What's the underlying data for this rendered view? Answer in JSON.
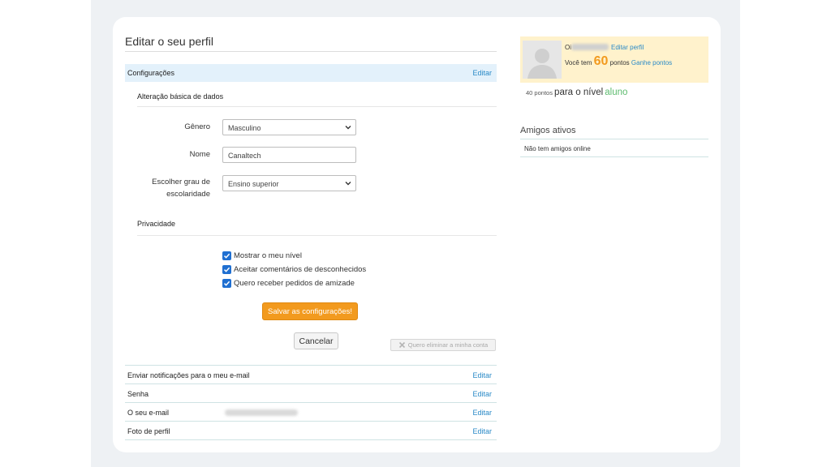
{
  "page": {
    "title": "Editar o seu perfil"
  },
  "settings": {
    "header_label": "Configurações",
    "edit_label": "Editar",
    "basic_data_title": "Alteração básica de dados",
    "gender": {
      "label": "Gênero",
      "value": "Masculino"
    },
    "name": {
      "label": "Nome",
      "value": "Canaltech"
    },
    "education": {
      "label_line1": "Escolher grau de",
      "label_line2": "escolaridade",
      "value": "Ensino superior"
    },
    "privacy_title": "Privacidade",
    "privacy_options": [
      {
        "label": "Mostrar o meu nível",
        "checked": true
      },
      {
        "label": "Aceitar comentários de desconhecidos",
        "checked": true
      },
      {
        "label": "Quero receber pedidos de amizade",
        "checked": true
      }
    ],
    "save_button": "Salvar as configurações!",
    "cancel_button": "Cancelar",
    "delete_button": "Quero eliminar a minha conta"
  },
  "rows": [
    {
      "label": "Enviar notificações para o meu e-mail",
      "edit": "Editar"
    },
    {
      "label": "Senha",
      "edit": "Editar"
    },
    {
      "label": "O seu e-mail",
      "edit": "Editar"
    },
    {
      "label": "Foto de perfil",
      "edit": "Editar"
    }
  ],
  "sidebar": {
    "greeting": "Oi",
    "edit_profile": "Editar perfil",
    "points_prefix": "Você tem",
    "points_value": "60",
    "points_suffix": "pontos",
    "earn_points": "Ganhe pontos",
    "level_points": "40 pontos",
    "level_text": "para o nível",
    "level_name": "aluno",
    "friends_title": "Amigos ativos",
    "friends_empty": "Não tem amigos online"
  },
  "colors": {
    "accent_link": "#2a8ac7",
    "save_button": "#f29a1e",
    "level_green": "#5dbb6e",
    "profile_box": "#fff2cc",
    "checkbox": "#1f6fd1"
  }
}
